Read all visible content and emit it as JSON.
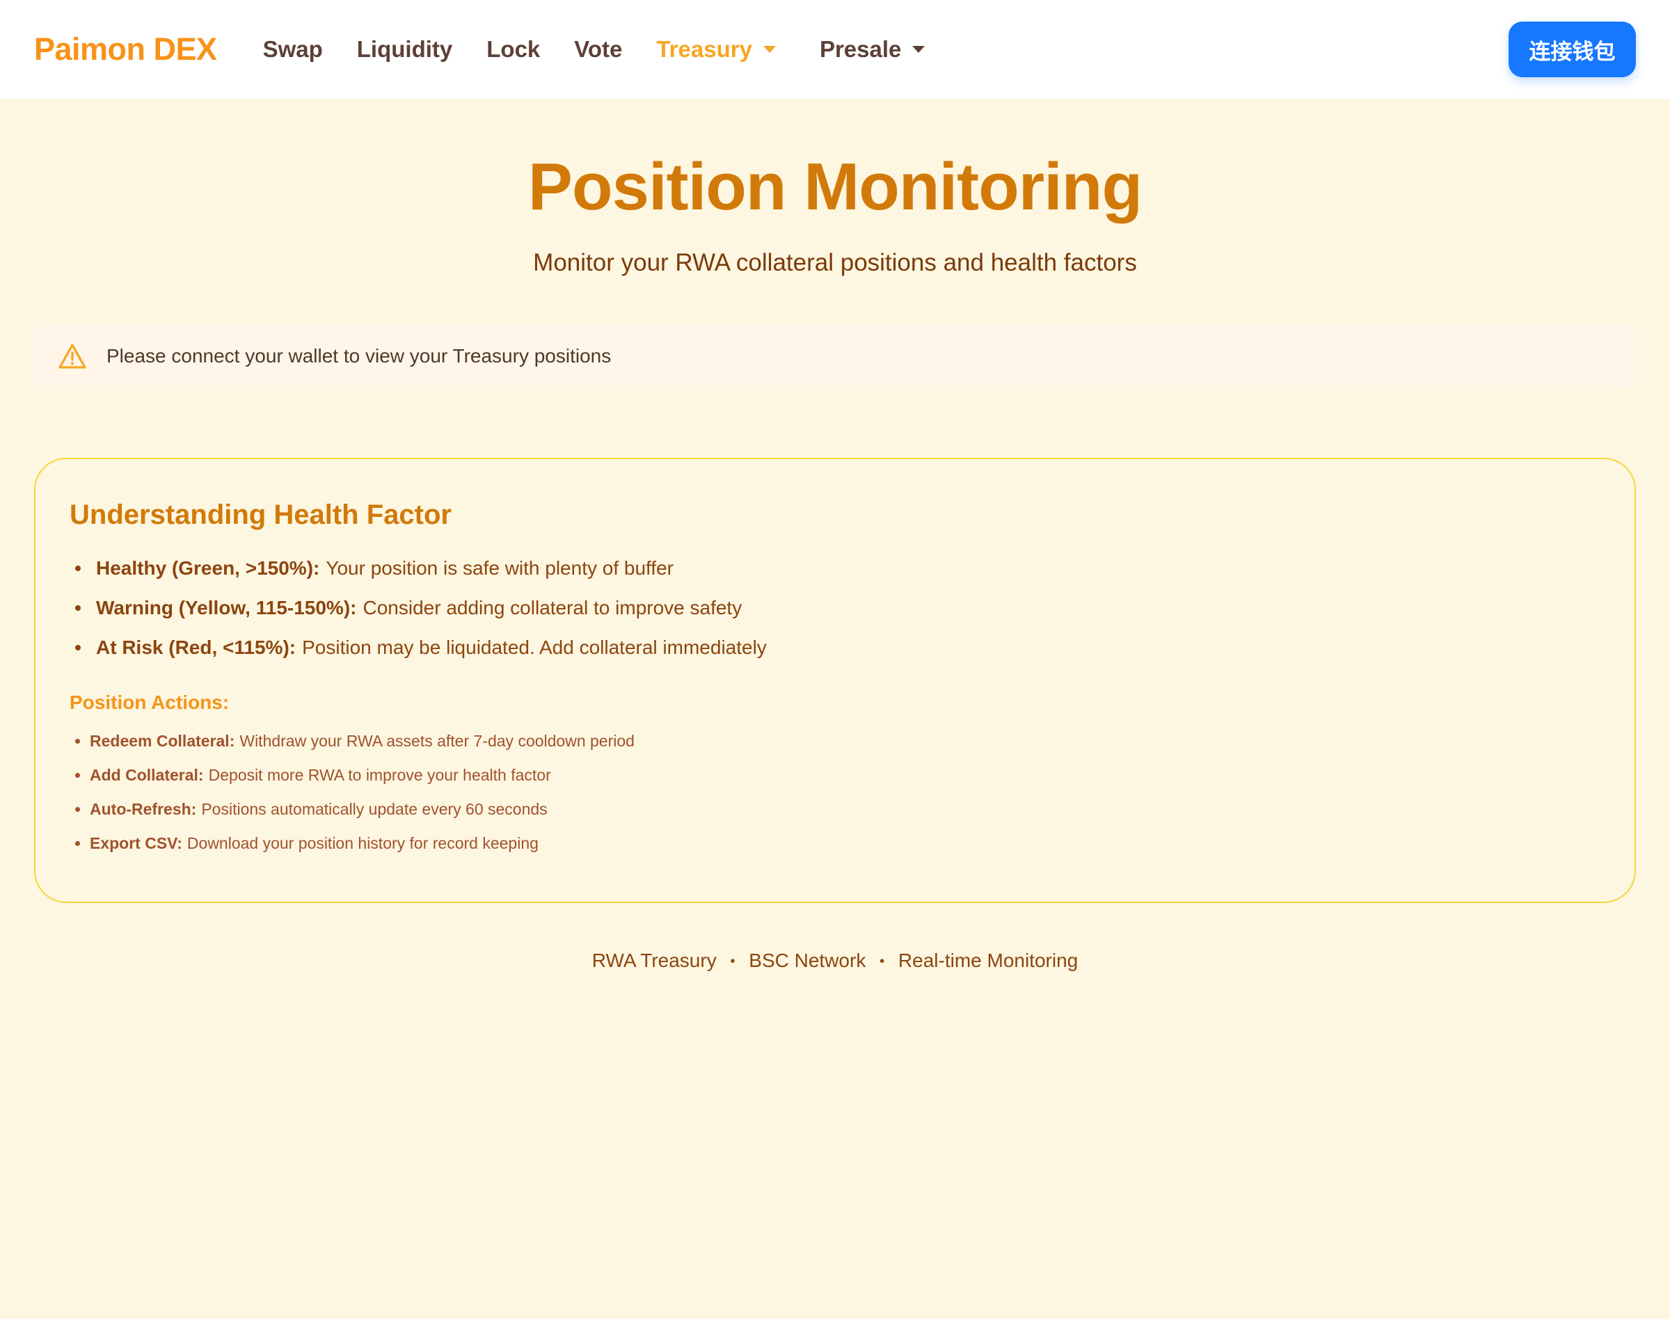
{
  "header": {
    "brand": "Paimon DEX",
    "nav": [
      {
        "label": "Swap"
      },
      {
        "label": "Liquidity"
      },
      {
        "label": "Lock"
      },
      {
        "label": "Vote"
      },
      {
        "label": "Treasury"
      },
      {
        "label": "Presale"
      }
    ],
    "connect_label": "连接钱包"
  },
  "colors": {
    "brand": "#f7931a",
    "active_nav": "#f5a623",
    "title": "#d17a0a",
    "button": "#1677ff",
    "background": "#fdf6e0",
    "card_border": "#f2d835"
  },
  "page": {
    "title": "Position Monitoring",
    "subtitle": "Monitor your RWA collateral positions and health factors"
  },
  "alert": {
    "icon": "warning-icon",
    "text": "Please connect your wallet to view your Treasury positions"
  },
  "info": {
    "title": "Understanding Health Factor",
    "levels": [
      {
        "label": "Healthy (Green, >150%):",
        "text": "Your position is safe with plenty of buffer"
      },
      {
        "label": "Warning (Yellow, 115-150%):",
        "text": "Consider adding collateral to improve safety"
      },
      {
        "label": "At Risk (Red, <115%):",
        "text": "Position may be liquidated. Add collateral immediately"
      }
    ],
    "actions_title": "Position Actions:",
    "actions": [
      {
        "label": "Redeem Collateral:",
        "text": "Withdraw your RWA assets after 7-day cooldown period"
      },
      {
        "label": "Add Collateral:",
        "text": "Deposit more RWA to improve your health factor"
      },
      {
        "label": "Auto-Refresh:",
        "text": "Positions automatically update every 60 seconds"
      },
      {
        "label": "Export CSV:",
        "text": "Download your position history for record keeping"
      }
    ]
  },
  "footer": {
    "items": [
      "RWA Treasury",
      "BSC Network",
      "Real-time Monitoring"
    ],
    "separator": "•"
  }
}
